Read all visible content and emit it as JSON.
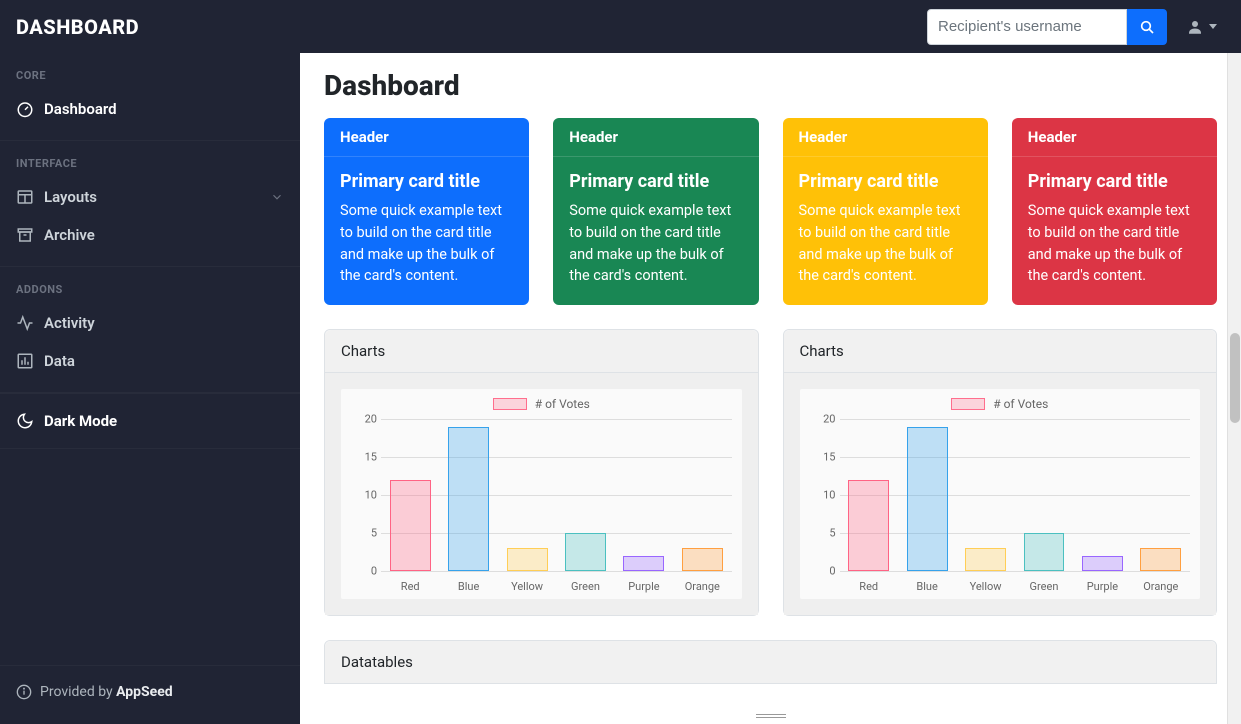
{
  "brand": "DASHBOARD",
  "search": {
    "placeholder": "Recipient's username"
  },
  "sidebar": {
    "sections": {
      "core": {
        "heading": "CORE",
        "items": [
          {
            "label": "Dashboard"
          }
        ]
      },
      "interface": {
        "heading": "INTERFACE",
        "items": [
          {
            "label": "Layouts"
          },
          {
            "label": "Archive"
          }
        ]
      },
      "addons": {
        "heading": "ADDONS",
        "items": [
          {
            "label": "Activity"
          },
          {
            "label": "Data"
          }
        ]
      }
    },
    "dark_mode": "Dark Mode",
    "footer_prefix": "Provided by ",
    "footer_brand": "AppSeed"
  },
  "page": {
    "title": "Dashboard"
  },
  "cards": [
    {
      "header": "Header",
      "title": "Primary card title",
      "text": "Some quick example text to build on the card title and make up the bulk of the card's content.",
      "color": "#0d6efd"
    },
    {
      "header": "Header",
      "title": "Primary card title",
      "text": "Some quick example text to build on the card title and make up the bulk of the card's content.",
      "color": "#198754"
    },
    {
      "header": "Header",
      "title": "Primary card title",
      "text": "Some quick example text to build on the card title and make up the bulk of the card's content.",
      "color": "#ffc107"
    },
    {
      "header": "Header",
      "title": "Primary card title",
      "text": "Some quick example text to build on the card title and make up the bulk of the card's content.",
      "color": "#dc3545"
    }
  ],
  "charts_panel_title": "Charts",
  "datatables_title": "Datatables",
  "chart_data": [
    {
      "type": "bar",
      "legend": "# of Votes",
      "categories": [
        "Red",
        "Blue",
        "Yellow",
        "Green",
        "Purple",
        "Orange"
      ],
      "values": [
        12,
        19,
        3,
        5,
        2,
        3
      ],
      "ylim": [
        0,
        20
      ],
      "yticks": [
        0,
        5,
        10,
        15,
        20
      ],
      "colors_fill": [
        "rgba(255,99,132,0.3)",
        "rgba(54,162,235,0.3)",
        "rgba(255,206,86,0.3)",
        "rgba(75,192,192,0.3)",
        "rgba(153,102,255,0.3)",
        "rgba(255,159,64,0.3)"
      ],
      "colors_border": [
        "rgba(255,99,132,1)",
        "rgba(54,162,235,1)",
        "rgba(255,206,86,1)",
        "rgba(75,192,192,1)",
        "rgba(153,102,255,1)",
        "rgba(255,159,64,1)"
      ]
    },
    {
      "type": "bar",
      "legend": "# of Votes",
      "categories": [
        "Red",
        "Blue",
        "Yellow",
        "Green",
        "Purple",
        "Orange"
      ],
      "values": [
        12,
        19,
        3,
        5,
        2,
        3
      ],
      "ylim": [
        0,
        20
      ],
      "yticks": [
        0,
        5,
        10,
        15,
        20
      ],
      "colors_fill": [
        "rgba(255,99,132,0.3)",
        "rgba(54,162,235,0.3)",
        "rgba(255,206,86,0.3)",
        "rgba(75,192,192,0.3)",
        "rgba(153,102,255,0.3)",
        "rgba(255,159,64,0.3)"
      ],
      "colors_border": [
        "rgba(255,99,132,1)",
        "rgba(54,162,235,1)",
        "rgba(255,206,86,1)",
        "rgba(75,192,192,1)",
        "rgba(153,102,255,1)",
        "rgba(255,159,64,1)"
      ]
    }
  ]
}
